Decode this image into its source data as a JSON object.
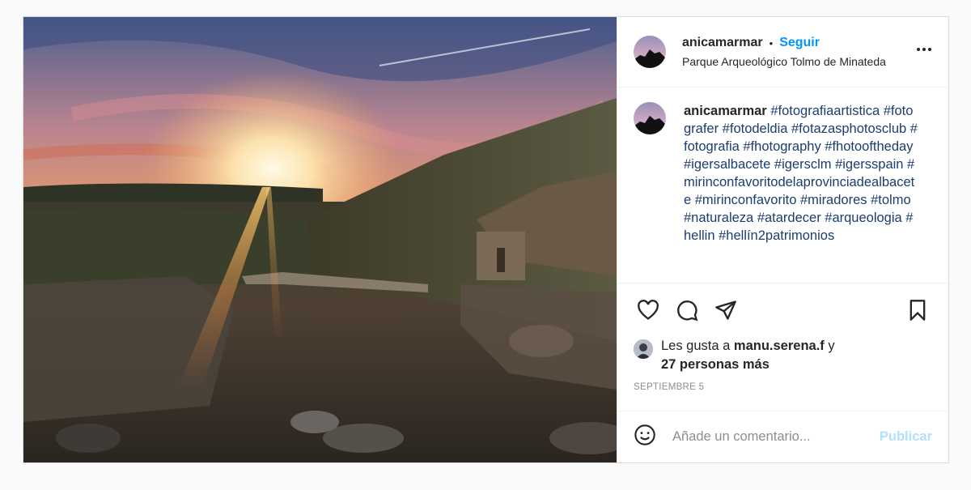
{
  "post": {
    "author": {
      "username": "anicamarmar",
      "location": "Parque Arqueológico Tolmo de Minateda"
    },
    "header": {
      "dot": "•",
      "follow_label": "Seguir",
      "more_icon": "more-options-icon"
    },
    "caption": {
      "username": "anicamarmar",
      "hashtags": "#fotografiaartistica #fotografer #fotodeldia #fotazasphotosclub #fotografia #fhotography #fhotooftheday #igersalbacete #igersclm #igersspain #mirinconfavoritodelaprovinciadealbacete #mirinconfavorito #miradores #tolmo #naturaleza #atardecer #arqueologia #hellin #hellín2patrimonios"
    },
    "actions": {
      "like_icon": "heart-icon",
      "comment_icon": "comment-icon",
      "share_icon": "share-icon",
      "save_icon": "bookmark-icon"
    },
    "likes": {
      "prefix": "Les gusta a",
      "liker": "manu.serena.f",
      "conjunction": "y",
      "others": "27 personas más"
    },
    "date": "SEPTIEMBRE 5",
    "comment_box": {
      "emoji_icon": "emoji-icon",
      "placeholder": "Añade un comentario...",
      "publish_label": "Publicar"
    },
    "colors": {
      "follow": "#0095f6",
      "hashtag": "#1c3d6e",
      "publish_disabled": "#b2dffc",
      "muted": "#8e8e8e"
    }
  }
}
